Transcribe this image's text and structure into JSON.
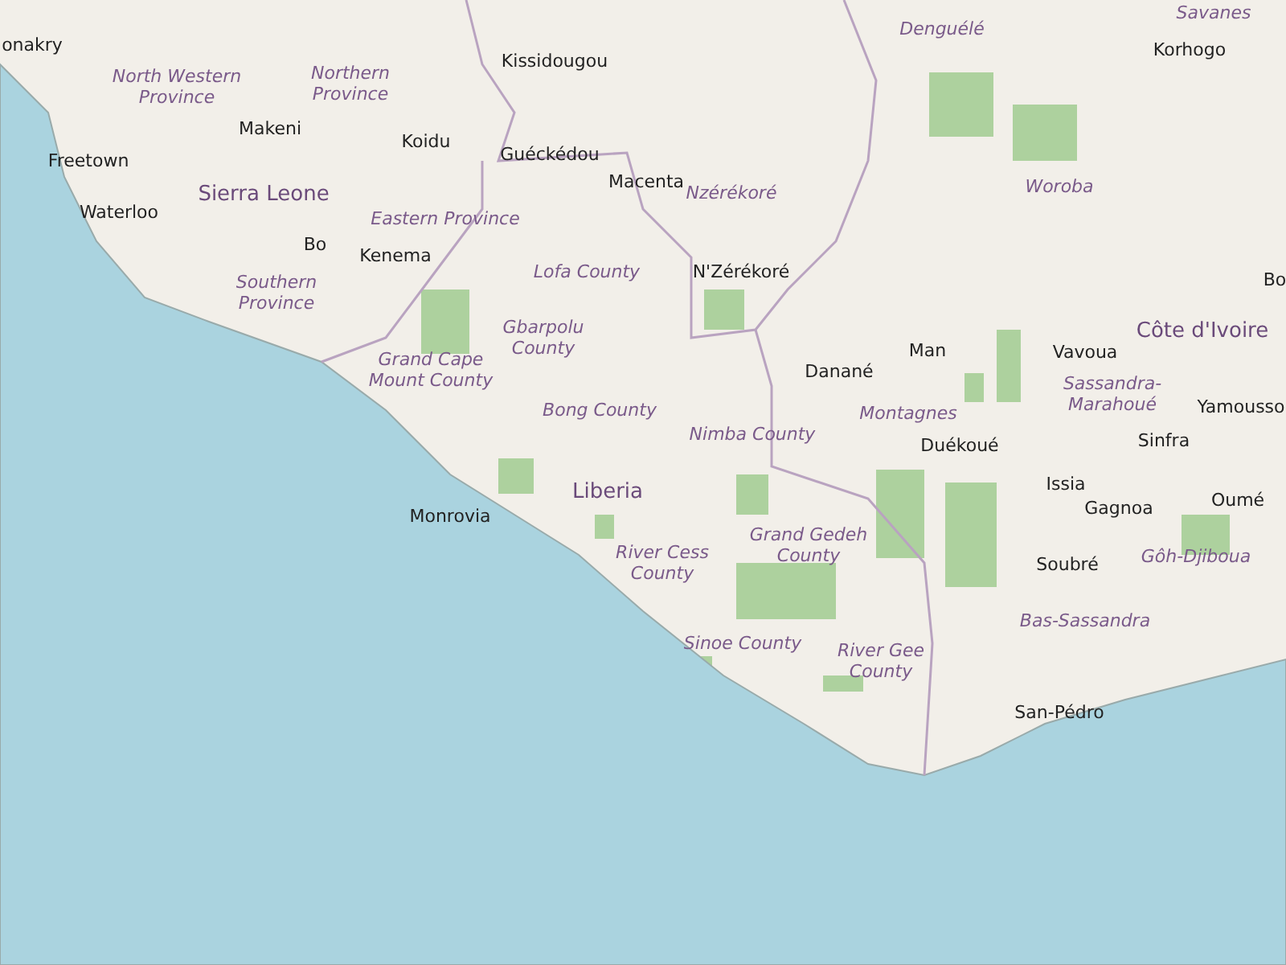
{
  "map": {
    "labels": [
      {
        "kind": "region",
        "text": "Savanes"
      },
      {
        "kind": "city",
        "text": "onakry"
      },
      {
        "kind": "region",
        "text": "Denguélé"
      },
      {
        "kind": "city",
        "text": "Korhogo"
      },
      {
        "kind": "city",
        "text": "Kissidougou"
      },
      {
        "kind": "region",
        "text": "North Western\nProvince"
      },
      {
        "kind": "region",
        "text": "Northern\nProvince"
      },
      {
        "kind": "city",
        "text": "Makeni"
      },
      {
        "kind": "city",
        "text": "Koidu"
      },
      {
        "kind": "city",
        "text": "Guéckédou"
      },
      {
        "kind": "city",
        "text": "Freetown"
      },
      {
        "kind": "country",
        "text": "Sierra Leone"
      },
      {
        "kind": "city",
        "text": "Macenta"
      },
      {
        "kind": "region",
        "text": "Nzérékoré"
      },
      {
        "kind": "region",
        "text": "Woroba"
      },
      {
        "kind": "city",
        "text": "Waterloo"
      },
      {
        "kind": "region",
        "text": "Eastern Province"
      },
      {
        "kind": "city",
        "text": "Bo"
      },
      {
        "kind": "city",
        "text": "Kenema"
      },
      {
        "kind": "region",
        "text": "Lofa County"
      },
      {
        "kind": "city",
        "text": "N'Zérékoré"
      },
      {
        "kind": "region",
        "text": "Southern\nProvince"
      },
      {
        "kind": "city",
        "text": "Bo"
      },
      {
        "kind": "region",
        "text": "Gbarpolu\nCounty"
      },
      {
        "kind": "country",
        "text": "Côte d'Ivoire"
      },
      {
        "kind": "city",
        "text": "Man"
      },
      {
        "kind": "city",
        "text": "Vavoua"
      },
      {
        "kind": "city",
        "text": "Danané"
      },
      {
        "kind": "region",
        "text": "Grand Cape\nMount County"
      },
      {
        "kind": "region",
        "text": "Sassandra-\nMarahoué"
      },
      {
        "kind": "region",
        "text": "Bong County"
      },
      {
        "kind": "region",
        "text": "Montagnes"
      },
      {
        "kind": "city",
        "text": "Yamousso"
      },
      {
        "kind": "region",
        "text": "Nimba County"
      },
      {
        "kind": "city",
        "text": "Duékoué"
      },
      {
        "kind": "city",
        "text": "Sinfra"
      },
      {
        "kind": "country",
        "text": "Liberia"
      },
      {
        "kind": "city",
        "text": "Issia"
      },
      {
        "kind": "city",
        "text": "Monrovia"
      },
      {
        "kind": "city",
        "text": "Gagnoa"
      },
      {
        "kind": "city",
        "text": "Oumé"
      },
      {
        "kind": "region",
        "text": "River Cess\nCounty"
      },
      {
        "kind": "region",
        "text": "Grand Gedeh\nCounty"
      },
      {
        "kind": "city",
        "text": "Soubré"
      },
      {
        "kind": "region",
        "text": "Gôh-Djiboua"
      },
      {
        "kind": "region",
        "text": "Bas-Sassandra"
      },
      {
        "kind": "region",
        "text": "Sinoe County"
      },
      {
        "kind": "region",
        "text": "River Gee\nCounty"
      },
      {
        "kind": "city",
        "text": "San-Pédro"
      }
    ]
  }
}
